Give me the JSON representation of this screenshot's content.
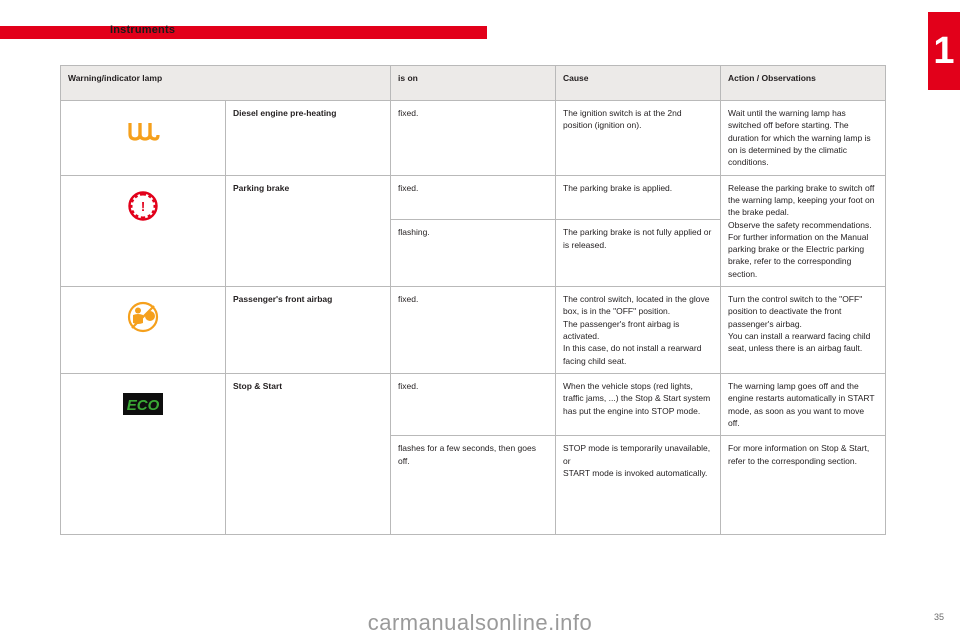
{
  "page": {
    "section_title": "Instruments",
    "page_number": "35",
    "watermark": "carmanualsonline.info",
    "chapter_number": "1",
    "accent_color": "#e2001a"
  },
  "table": {
    "headers": [
      "Warning/indicator lamp",
      "is on",
      "Cause",
      "Action / Observations"
    ],
    "rows": [
      {
        "icon": "diesel-preheating-coil-icon",
        "lamp": "Diesel engine pre-heating",
        "states": [
          {
            "is_on": "fixed.",
            "cause": "The ignition switch is at the 2nd position (ignition on).",
            "action": "Wait until the warning lamp has switched off before starting. The duration for which the warning lamp is on is determined by the climatic conditions."
          }
        ]
      },
      {
        "icon": "parking-brake-icon",
        "lamp": "Parking brake",
        "states": [
          {
            "is_on": "fixed.",
            "cause": "The parking brake is applied.",
            "action": "Release the parking brake to switch off the warning lamp, keeping your foot on the brake pedal.\nObserve the safety recommendations.\nFor further information on the Manual parking brake or the Electric parking brake, refer to the corresponding section."
          },
          {
            "is_on": "flashing.",
            "cause": "The parking brake is not fully applied or is released.",
            "action": ""
          }
        ]
      },
      {
        "icon": "passenger-airbag-icon",
        "lamp": "Passenger's front airbag",
        "states": [
          {
            "is_on": "fixed.",
            "cause": "The control switch, located in the glove box, is in the \"OFF\" position.\nThe passenger's front airbag is activated.\nIn this case, do not install a rearward facing child seat.",
            "action": "Turn the control switch to the \"OFF\" position to deactivate the front passenger's airbag.\nYou can install a rearward facing child seat, unless there is an airbag fault."
          }
        ]
      },
      {
        "icon": "eco-stop-start-icon",
        "lamp": "Stop & Start",
        "states": [
          {
            "is_on": "fixed.",
            "cause": "When the vehicle stops (red lights, traffic jams, ...) the Stop & Start system has put the engine into STOP mode.",
            "action": "The warning lamp goes off and the engine restarts automatically in START mode, as soon as you want to move off."
          },
          {
            "is_on": "flashes for a few seconds, then goes off.",
            "cause": "STOP mode is temporarily unavailable,\nor\nSTART mode is invoked automatically.",
            "action": "For more information on Stop & Start, refer to the corresponding section."
          }
        ]
      }
    ]
  },
  "icons": {
    "diesel_preheating_color": "#f5a01c",
    "parking_brake_color": "#e2001a",
    "airbag_color": "#f5a01c",
    "eco_bg": "#0e0e0e",
    "eco_text_color": "#3aa935",
    "eco_label": "ECO"
  }
}
